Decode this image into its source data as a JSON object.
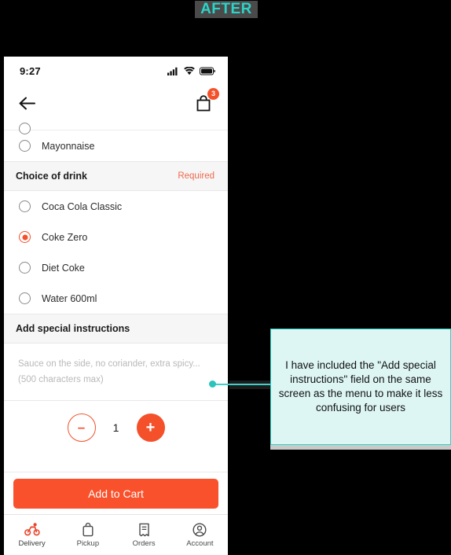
{
  "banner": {
    "label": "AFTER"
  },
  "phone": {
    "status_bar": {
      "time": "9:27",
      "icons": [
        "cellular-signal-icon",
        "wifi-icon",
        "battery-icon"
      ]
    },
    "nav_bar": {
      "back_icon": "back-arrow-icon",
      "cart_icon": "shopping-bag-icon",
      "cart_badge_count": "3"
    },
    "options_above": [
      {
        "label": "Mayonnaise",
        "selected": false
      }
    ],
    "drink_section": {
      "title": "Choice of drink",
      "required_label": "Required",
      "options": [
        {
          "label": "Coca Cola Classic",
          "selected": false
        },
        {
          "label": "Coke Zero",
          "selected": true
        },
        {
          "label": "Diet Coke",
          "selected": false
        },
        {
          "label": "Water 600ml",
          "selected": false
        }
      ]
    },
    "instructions_section": {
      "title": "Add special instructions",
      "placeholder_line1": "Sauce on the side, no coriander, extra spicy...",
      "placeholder_line2": "(500 characters max)",
      "value": ""
    },
    "quantity": {
      "decrement_label": "–",
      "value": "1",
      "increment_label": "+"
    },
    "cta": {
      "label": "Add to Cart"
    },
    "tab_bar": [
      {
        "label": "Delivery",
        "icon": "delivery-bike-icon",
        "active": true
      },
      {
        "label": "Pickup",
        "icon": "pickup-bag-icon",
        "active": false
      },
      {
        "label": "Orders",
        "icon": "orders-receipt-icon",
        "active": false
      },
      {
        "label": "Account",
        "icon": "account-person-icon",
        "active": false
      }
    ]
  },
  "annotation": {
    "text": "I have included the \"Add special instructions\" field on the same screen as the menu to make it less confusing for users"
  },
  "colors": {
    "accent": "#f4502a",
    "cta": "#f9512c",
    "required": "#ef6b4e",
    "annotation_border": "#2ed3c8",
    "annotation_bg": "#ddf6f4",
    "banner_text": "#2ed3c8"
  }
}
